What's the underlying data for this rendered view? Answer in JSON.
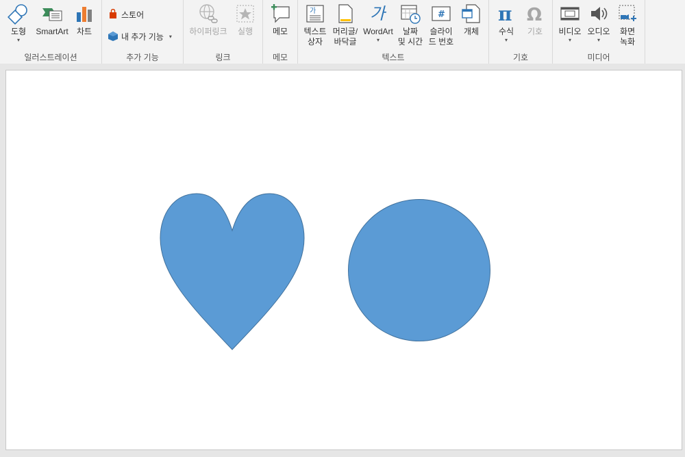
{
  "ribbon": {
    "groups": {
      "illustrations": {
        "label": "일러스트레이션",
        "shapes": "도형",
        "smartart": "SmartArt",
        "chart": "차트"
      },
      "addins": {
        "label": "추가 기능",
        "store": "스토어",
        "my_addins": "내 추가 기능"
      },
      "links": {
        "label": "링크",
        "hyperlink": "하이퍼링크",
        "action": "실행"
      },
      "comments": {
        "label": "메모",
        "comment": "메모"
      },
      "text": {
        "label": "텍스트",
        "textbox": "텍스트\n상자",
        "header_footer": "머리글/\n바닥글",
        "wordart": "WordArt",
        "datetime": "날짜\n및 시간",
        "slide_number": "슬라이\n드 번호",
        "object": "개체"
      },
      "symbols": {
        "label": "기호",
        "equation": "수식",
        "symbol": "기호"
      },
      "media": {
        "label": "미디어",
        "video": "비디오",
        "audio": "오디오",
        "screen_recording": "화면\n녹화"
      }
    }
  },
  "slide": {
    "shapes": [
      {
        "type": "heart",
        "fill": "#5b9bd5",
        "stroke": "#41719c"
      },
      {
        "type": "circle",
        "fill": "#5b9bd5",
        "stroke": "#41719c"
      }
    ]
  },
  "colors": {
    "accent": "#2e75b6",
    "shape_fill": "#5b9bd5",
    "shape_stroke": "#41719c",
    "store_red": "#d83b01"
  }
}
